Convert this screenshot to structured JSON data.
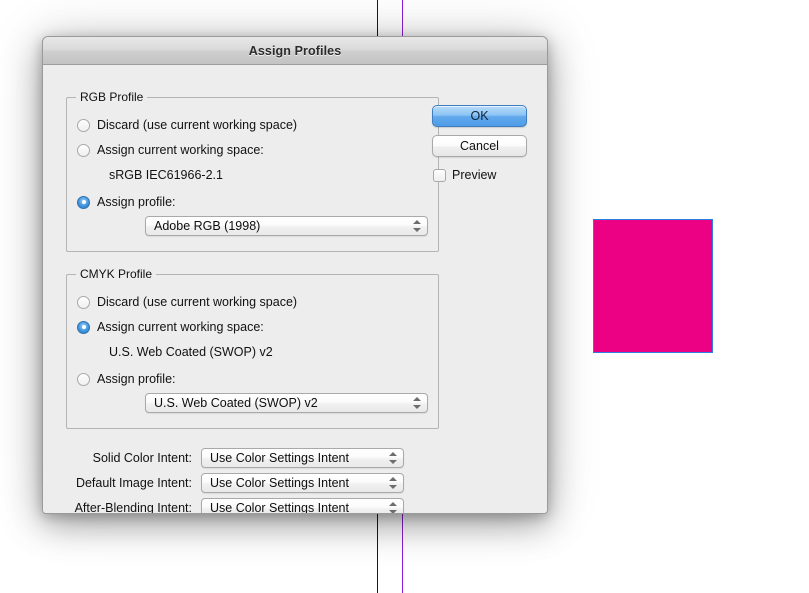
{
  "canvas": {
    "background_color": "#ffffff",
    "artwork_rect": {
      "name": "magenta-rectangle",
      "fill_color": "#ec0084",
      "selection_border_color": "#2a7fe0"
    },
    "guides": [
      {
        "name": "guide-black",
        "color": "#1a1a1a"
      },
      {
        "name": "guide-purple",
        "color": "#8b1fd4"
      }
    ]
  },
  "dialog": {
    "title": "Assign Profiles",
    "rgb_group": {
      "legend": "RGB Profile",
      "options": [
        {
          "label": "Discard (use current working space)",
          "selected": false
        },
        {
          "label": "Assign current working space:",
          "selected": false
        },
        {
          "label": "Assign profile:",
          "selected": true
        }
      ],
      "working_space_value": "sRGB IEC61966-2.1",
      "profile_popup_value": "Adobe RGB (1998)"
    },
    "cmyk_group": {
      "legend": "CMYK Profile",
      "options": [
        {
          "label": "Discard (use current working space)",
          "selected": false
        },
        {
          "label": "Assign current working space:",
          "selected": true
        },
        {
          "label": "Assign profile:",
          "selected": false
        }
      ],
      "working_space_value": "U.S. Web Coated (SWOP) v2",
      "profile_popup_value": "U.S. Web Coated (SWOP) v2"
    },
    "intents": [
      {
        "label": "Solid Color Intent:",
        "value": "Use Color Settings Intent"
      },
      {
        "label": "Default Image Intent:",
        "value": "Use Color Settings Intent"
      },
      {
        "label": "After-Blending Intent:",
        "value": "Use Color Settings Intent"
      }
    ],
    "buttons": {
      "ok": "OK",
      "cancel": "Cancel"
    },
    "preview": {
      "label": "Preview",
      "checked": false
    },
    "accent_color": "#4e9ce8"
  }
}
